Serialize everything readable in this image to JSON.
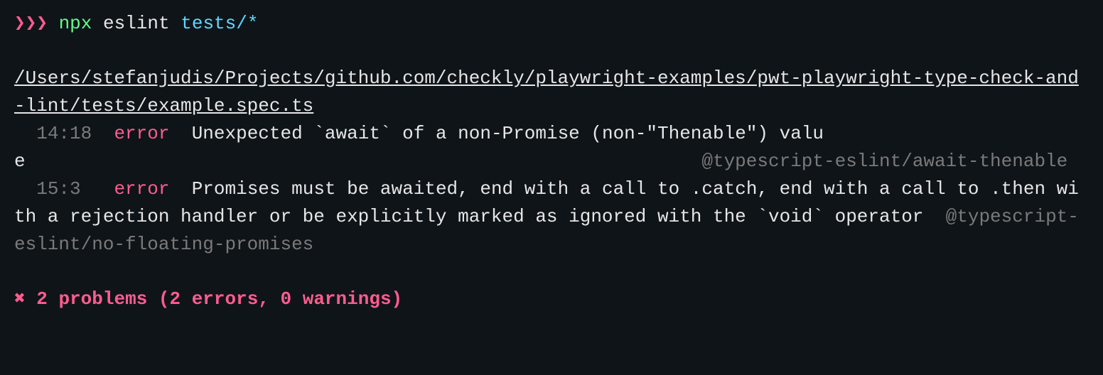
{
  "prompt": {
    "symbol": "❯❯❯",
    "cmd_part1": "npx",
    "cmd_part2": "eslint",
    "cmd_part3": "tests/*"
  },
  "file_path": "/Users/stefanjudis/Projects/github.com/checkly/playwright-examples/pwt-playwright-type-check-and-lint/tests/example.spec.ts",
  "errors": [
    {
      "location": "14:18",
      "severity": "error",
      "message": "Unexpected `await` of a non-Promise (non-\"Thenable\") value",
      "rule": "@typescript-eslint/await-thenable"
    },
    {
      "location": "15:3",
      "severity": "error",
      "message": "Promises must be awaited, end with a call to .catch, end with a call to .then with a rejection handler or be explicitly marked as ignored with the `void` operator",
      "rule": "@typescript-eslint/no-floating-promises"
    }
  ],
  "summary": {
    "cross": "✖",
    "text": "2 problems (2 errors, 0 warnings)"
  }
}
